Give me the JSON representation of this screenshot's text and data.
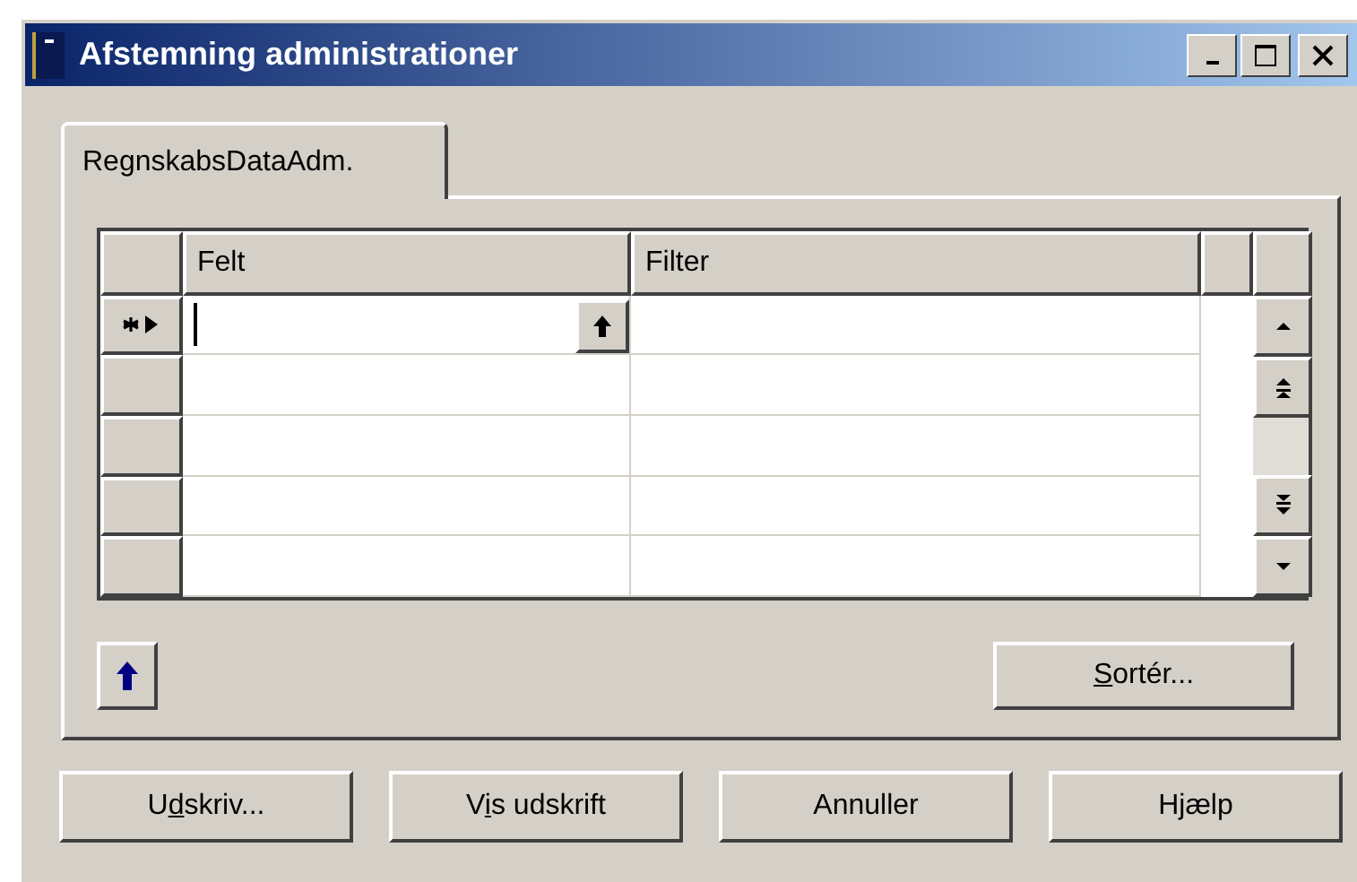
{
  "window": {
    "title": "Afstemning administrationer"
  },
  "tabs": [
    {
      "label": "RegnskabsDataAdm.",
      "selected": true
    }
  ],
  "grid": {
    "columns": [
      "Felt",
      "Filter"
    ],
    "rows": [
      {
        "current": true
      },
      {
        "current": false
      },
      {
        "current": false
      },
      {
        "current": false
      },
      {
        "current": false
      }
    ]
  },
  "sort_button": {
    "key": "S",
    "after": "ortér..."
  },
  "buttons": [
    {
      "before": "U",
      "key": "d",
      "after": "skriv..."
    },
    {
      "before": "V",
      "key": "i",
      "after": "s udskrift"
    },
    {
      "after": "Annuller"
    },
    {
      "after": "Hjælp"
    }
  ]
}
